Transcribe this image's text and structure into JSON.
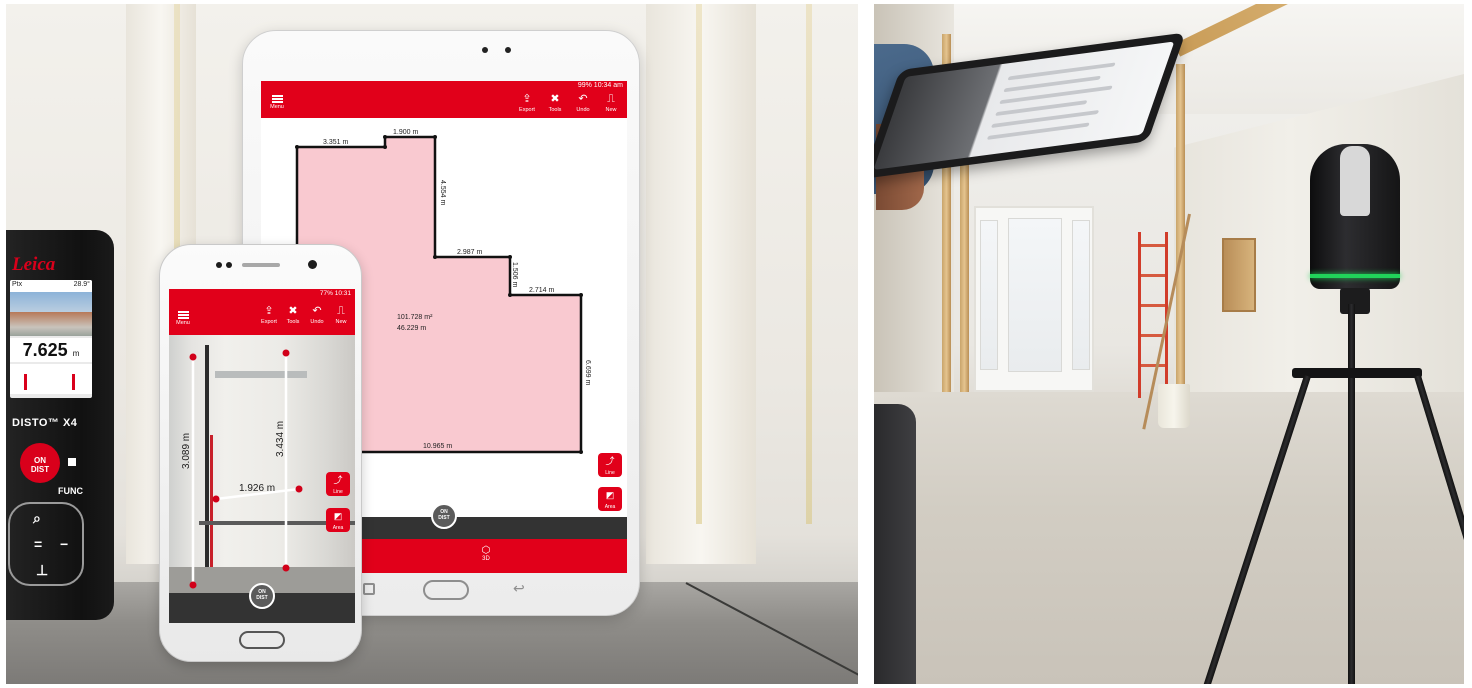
{
  "disto": {
    "brand": "Leica",
    "status_left": "Ptx",
    "status_right": "28.9°",
    "measurement": "7.625",
    "unit": "m",
    "model": "DISTO™ X4",
    "on_button": "ON\nDIST",
    "func_label": "FUNC"
  },
  "tablet_app": {
    "status": "99% 10:34 am",
    "menu_label": "Menu",
    "actions": [
      {
        "glyph": "⇪",
        "label": "Export"
      },
      {
        "glyph": "✖",
        "label": "Tools"
      },
      {
        "glyph": "↶",
        "label": "Undo"
      },
      {
        "glyph": "⎍",
        "label": "New"
      }
    ],
    "dimensions": {
      "d1": "3.351 m",
      "d2": "1.900 m",
      "d3": "4.554 m",
      "d4": "2.987 m",
      "d5": "1.506 m",
      "d6": "2.714 m",
      "d7": "6.699 m",
      "d8": "10.965 m"
    },
    "area": "101.728 m²",
    "perimeter": "46.229 m",
    "line_button": "Line",
    "area_button": "Area",
    "on_dist": "ON\nDIST",
    "tab_3d_label": "3D",
    "plan_fill": "#f9c9d0"
  },
  "phone_app": {
    "status": "77% 10:31",
    "menu_label": "Menu",
    "actions": [
      {
        "glyph": "⇪",
        "label": "Export"
      },
      {
        "glyph": "✖",
        "label": "Tools"
      },
      {
        "glyph": "↶",
        "label": "Undo"
      },
      {
        "glyph": "⎍",
        "label": "New"
      }
    ],
    "measure_vertical_left": "3.089 m",
    "measure_vertical_right": "3.434 m",
    "measure_horizontal": "1.926 m",
    "line_button": "Line",
    "area_button": "Area",
    "on_dist": "ON\nDIST"
  },
  "colors": {
    "accent": "#e1001a",
    "dark_bar": "#333333",
    "scanner_ring": "#21d35a"
  }
}
